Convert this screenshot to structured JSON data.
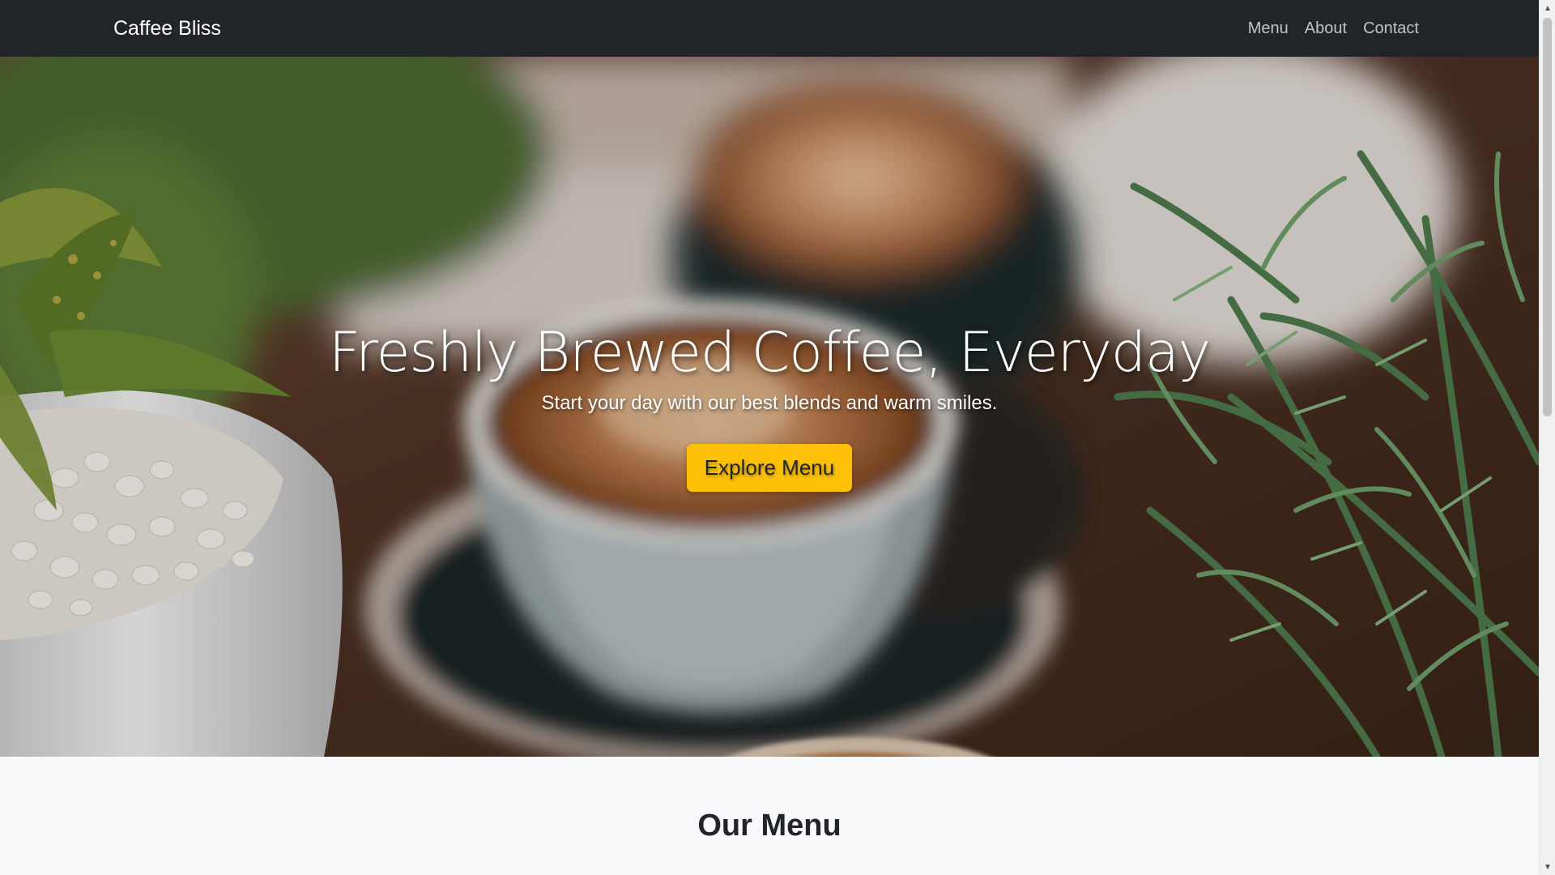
{
  "navbar": {
    "brand": "Caffee Bliss",
    "links": [
      "Menu",
      "About",
      "Contact"
    ]
  },
  "hero": {
    "title": "Freshly Brewed Coffee, Everyday",
    "subtitle": "Start your day with our best blends and warm smiles.",
    "button_label": "Explore Menu",
    "image_description": "background-photo"
  },
  "menu_section": {
    "heading": "Our Menu"
  },
  "colors": {
    "navbar_bg": "#212529",
    "accent": "#ffc107",
    "section_bg": "#f8f9fa"
  },
  "icons": {
    "scroll_up": "triangle-up-icon",
    "scroll_down": "triangle-down-icon"
  },
  "scroll": {
    "position_fraction": 0.0
  }
}
